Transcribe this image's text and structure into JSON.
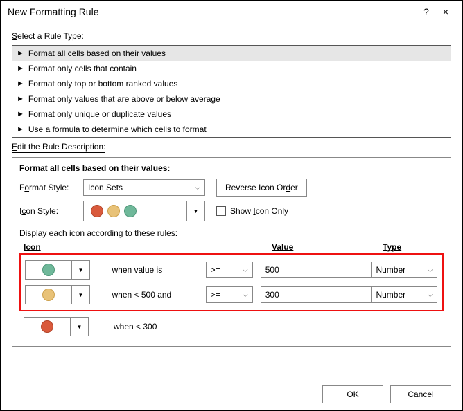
{
  "window": {
    "title": "New Formatting Rule",
    "help": "?",
    "close": "×"
  },
  "sections": {
    "selectLabel": "Select a Rule Type:",
    "editLabel": "Edit the Rule Description:"
  },
  "ruleTypes": [
    "Format all cells based on their values",
    "Format only cells that contain",
    "Format only top or bottom ranked values",
    "Format only values that are above or below average",
    "Format only unique or duplicate values",
    "Use a formula to determine which cells to format"
  ],
  "desc": {
    "title": "Format all cells based on their values:",
    "formatStyleLabel": "Format Style:",
    "formatStyle": "Icon Sets",
    "reverseBtn": "Reverse Icon Order",
    "iconStyleLabel": "Icon Style:",
    "showIconOnly": "Show Icon Only",
    "displayCaption": "Display each icon according to these rules:"
  },
  "headers": {
    "icon": "Icon",
    "value": "Value",
    "type": "Type"
  },
  "rules": [
    {
      "text": "when value is",
      "op": ">=",
      "value": "500",
      "type": "Number"
    },
    {
      "text": "when < 500 and",
      "op": ">=",
      "value": "300",
      "type": "Number"
    },
    {
      "text": "when < 300"
    }
  ],
  "footer": {
    "ok": "OK",
    "cancel": "Cancel"
  }
}
